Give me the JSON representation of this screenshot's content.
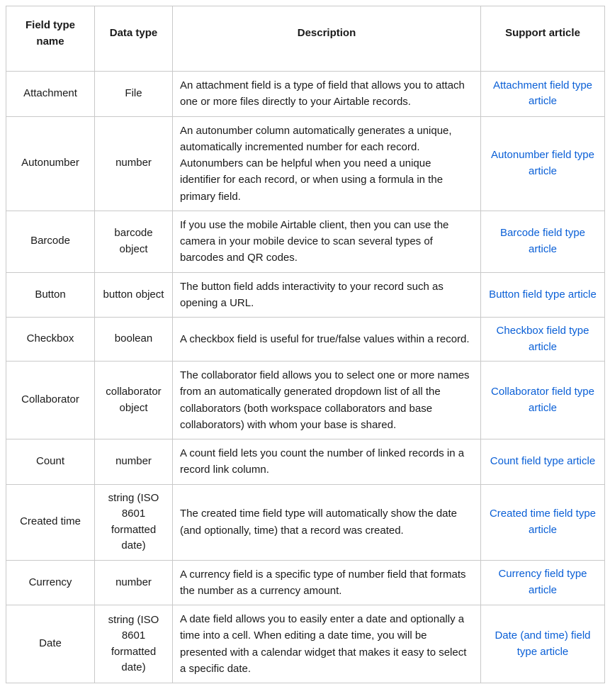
{
  "headers": {
    "name": "Field type name",
    "dataType": "Data type",
    "description": "Description",
    "support": "Support article"
  },
  "rows": [
    {
      "name": "Attachment",
      "dataType": "File",
      "description": "An attachment field is a type of field that allows you to attach one or more files directly to your Airtable records.",
      "supportLabel": "Attachment field type article"
    },
    {
      "name": "Autonumber",
      "dataType": "number",
      "description": "An autonumber column automatically generates a unique, automatically incremented number for each record. Autonumbers can be helpful when you need a unique identifier for each record, or when using a formula in the primary field.",
      "supportLabel": "Autonumber field type article"
    },
    {
      "name": "Barcode",
      "dataType": "barcode object",
      "description": "If you use the mobile Airtable client, then you can use the camera in your mobile device to scan several types of barcodes and QR codes.",
      "supportLabel": "Barcode field type article"
    },
    {
      "name": "Button",
      "dataType": "button object",
      "description": "The button field adds interactivity to your record such as opening a URL.",
      "supportLabel": "Button field type article"
    },
    {
      "name": "Checkbox",
      "dataType": "boolean",
      "description": "A checkbox field is useful for true/false values within a record.",
      "supportLabel": "Checkbox field type article"
    },
    {
      "name": "Collaborator",
      "dataType": "collaborator object",
      "description": "The collaborator field allows you to select one or more names from an automatically generated dropdown list of all the collaborators (both workspace collaborators and base collaborators) with whom your base is shared.",
      "supportLabel": "Collaborator field type article"
    },
    {
      "name": "Count",
      "dataType": "number",
      "description": "A count field lets you count the number of linked records in a record link column.",
      "supportLabel": "Count field type article"
    },
    {
      "name": "Created time",
      "dataType": "string (ISO 8601 formatted date)",
      "description": "The created time field type will automatically show the date (and optionally, time) that a record was created.",
      "supportLabel": "Created time field type article"
    },
    {
      "name": "Currency",
      "dataType": "number",
      "description": "A currency field is a specific type of number field that formats the number as a currency amount.",
      "supportLabel": "Currency field type article"
    },
    {
      "name": "Date",
      "dataType": "string (ISO 8601 formatted date)",
      "description": "A date field allows you to easily enter a date and optionally a time into a cell. When editing a date time, you will be presented with a calendar widget that makes it easy to select a specific date.",
      "supportLabel": "Date (and time) field type article"
    }
  ]
}
